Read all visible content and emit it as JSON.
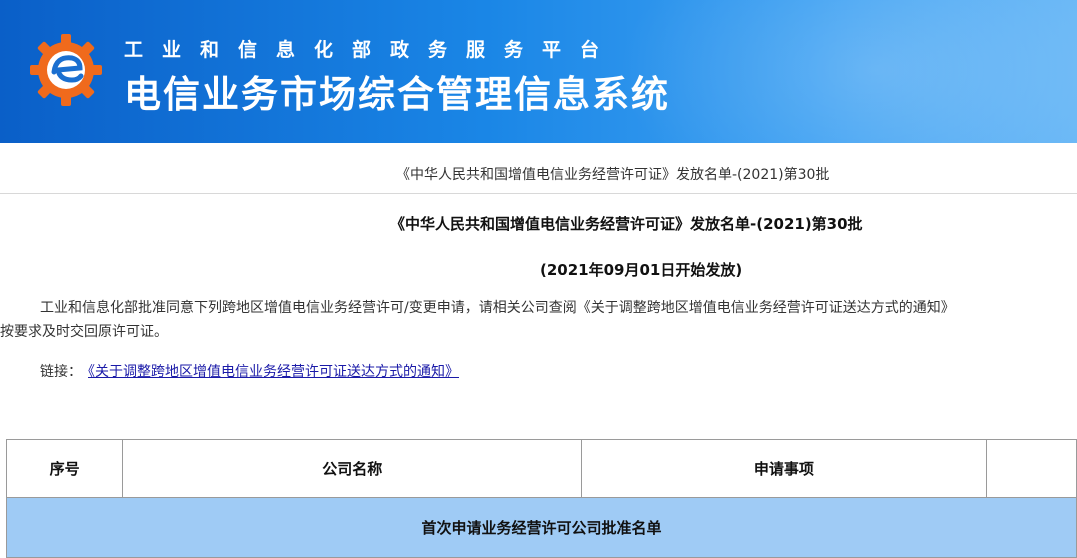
{
  "header": {
    "subtitle": "工业和信息化部政务服务平台",
    "title": "电信业务市场综合管理信息系统",
    "logo": "miit-gear-logo"
  },
  "breadcrumb": {
    "text": "《中华人民共和国增值电信业务经营许可证》发放名单-(2021)第30批"
  },
  "document": {
    "title": "《中华人民共和国增值电信业务经营许可证》发放名单-(2021)第30批",
    "date": "(2021年09月01日开始发放)",
    "paragraph_line1": "工业和信息化部批准同意下列跨地区增值电信业务经营许可/变更申请，请相关公司查阅《关于调整跨地区增值电信业务经营许可证送达方式的通知》",
    "paragraph_line2": "按要求及时交回原许可证。",
    "link_label": "链接：",
    "link_text": "《关于调整跨地区增值电信业务经营许可证送达方式的通知》"
  },
  "table": {
    "columns": [
      "序号",
      "公司名称",
      "申请事项",
      ""
    ],
    "section_title": "首次申请业务经营许可公司批准名单"
  },
  "colors": {
    "banner_start": "#0a5fc8",
    "banner_end": "#6ab8f6",
    "logo_orange": "#f06a1c",
    "section_row": "#9fcbf5",
    "link": "#1a1aa8"
  }
}
